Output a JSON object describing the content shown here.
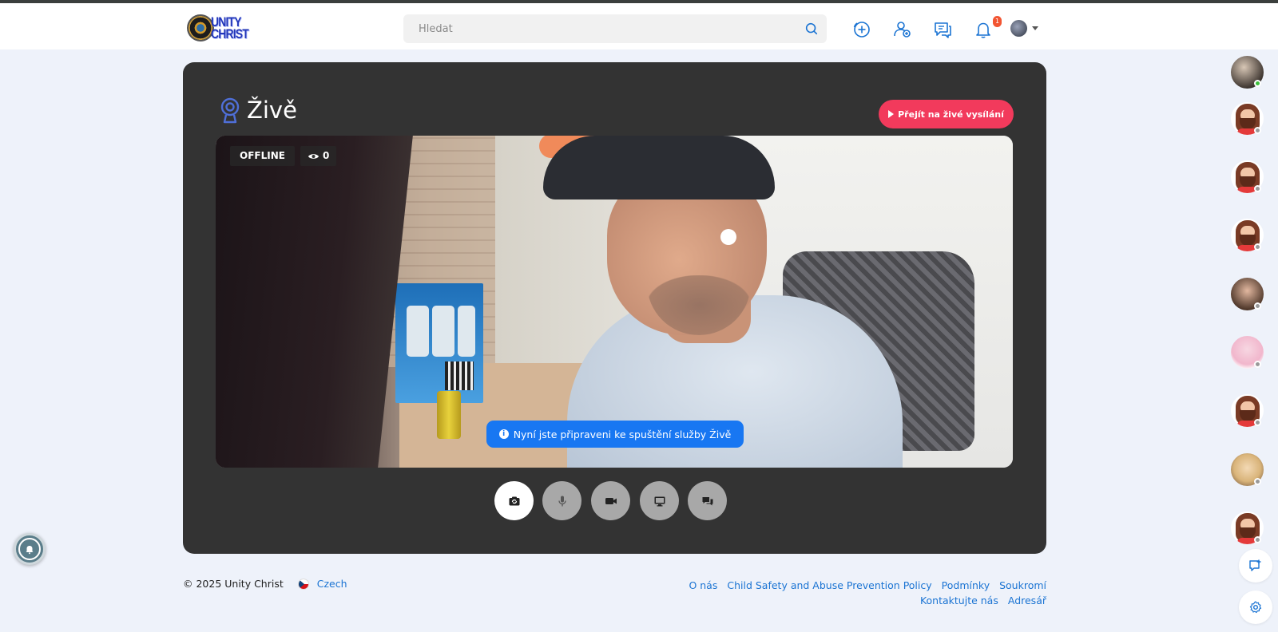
{
  "app": {
    "name": "Unity Christ"
  },
  "header": {
    "logo_text": "UNITY CHRIST",
    "search_placeholder": "Hledat",
    "icons": [
      "add-circle-icon",
      "add-friend-icon",
      "chat-icon",
      "bell-icon",
      "avatar"
    ],
    "notification_count": "1"
  },
  "live": {
    "title": "Živě",
    "go_live_label": "Přejít na živé vysílání",
    "status": "OFFLINE",
    "viewers": "0",
    "ready_message": "Nyní jste připraveni ke spuštění služby Živě",
    "controls": [
      "camera-switch-icon",
      "microphone-icon",
      "video-camera-icon",
      "screen-share-icon",
      "chat-bubbles-icon"
    ]
  },
  "footer": {
    "copyright": "© 2025 Unity Christ",
    "language": "Czech",
    "links": [
      "O nás",
      "Child Safety and Abuse Prevention Policy",
      "Podmínky",
      "Soukromí",
      "Kontaktujte nás",
      "Adresář"
    ]
  },
  "colors": {
    "accent_red": "#f23a5c",
    "primary_blue": "#1877f2",
    "link_blue": "#1b74d3",
    "card_bg": "#333333",
    "page_bg": "#eef2fa"
  }
}
